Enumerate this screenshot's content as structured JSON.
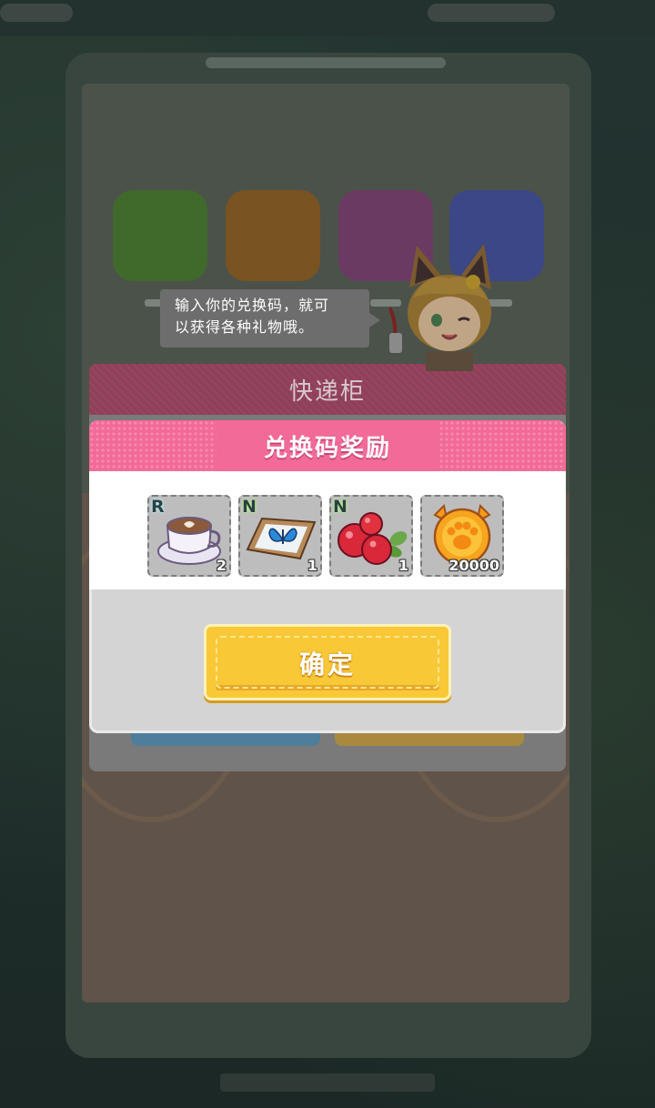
{
  "speech_bubble": {
    "text_line1": "输入你的兑换码，就可",
    "text_line2": "以获得各种礼物哦。"
  },
  "locker_dialog": {
    "title": "快递柜"
  },
  "reward_dialog": {
    "title": "兑换码奖励",
    "items": [
      {
        "rarity": "R",
        "name_icon": "coffee-cup-icon",
        "quantity": "2"
      },
      {
        "rarity": "N",
        "name_icon": "butterfly-specimen-icon",
        "quantity": "1"
      },
      {
        "rarity": "N",
        "name_icon": "berries-icon",
        "quantity": "1"
      },
      {
        "rarity": "",
        "name_icon": "paw-coin-icon",
        "quantity": "20000"
      }
    ],
    "confirm_label": "确定"
  },
  "colors": {
    "header_pink": "#f26a98",
    "confirm_yellow": "#f9c837",
    "locker_header": "#95445f"
  }
}
